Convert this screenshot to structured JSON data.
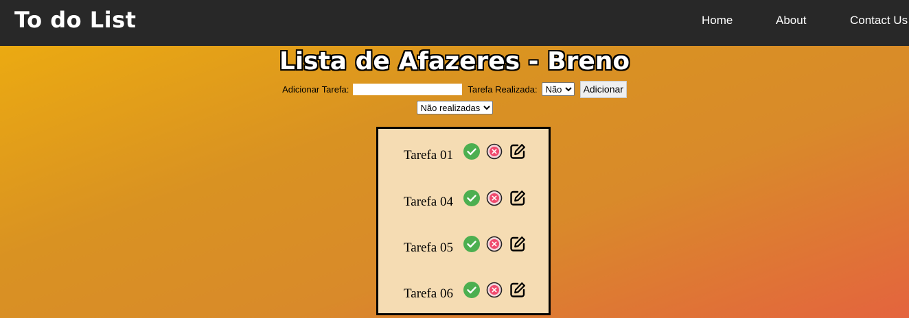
{
  "header": {
    "brand": "To do List",
    "nav": [
      "Home",
      "About",
      "Contact Us"
    ]
  },
  "title": "Lista de Afazeres - Breno",
  "form": {
    "task_label": "Adicionar Tarefa:",
    "task_value": "",
    "done_label": "Tarefa Realizada:",
    "done_selected": "Não",
    "add_button": "Adicionar"
  },
  "filter": {
    "selected": "Não realizadas"
  },
  "tasks": [
    {
      "label": "Tarefa 01"
    },
    {
      "label": "Tarefa 04"
    },
    {
      "label": "Tarefa 05"
    },
    {
      "label": "Tarefa 06"
    }
  ],
  "colors": {
    "navbar": "#282828",
    "check": "#4caf50",
    "delete": "#f04a6e",
    "task_box": "#f5dcb3"
  },
  "icons": [
    "check-circle-icon",
    "close-circle-icon",
    "edit-icon"
  ]
}
